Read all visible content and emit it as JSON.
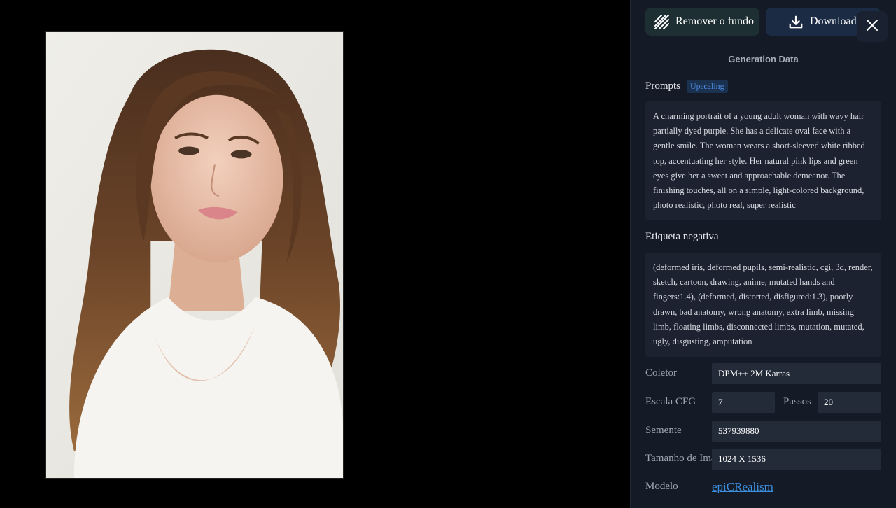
{
  "actions": {
    "remove_bg_label": "Remover o fundo",
    "download_label": "Download"
  },
  "generation": {
    "section_title": "Generation Data",
    "prompts_label": "Prompts",
    "prompts_tag": "Upscaling",
    "prompt_text": "A charming portrait of a young adult woman with wavy hair partially dyed purple. She has a delicate oval face with a gentle smile. The woman wears a short-sleeved white ribbed top, accentuating her style. Her natural pink lips and green eyes give her a sweet and approachable demeanor. The finishing touches, all on a simple, light-colored background, photo realistic, photo real, super realistic",
    "negative_label": "Etiqueta negativa",
    "negative_text": "(deformed iris, deformed pupils, semi-realistic, cgi, 3d, render, sketch, cartoon, drawing, anime, mutated hands and fingers:1.4), (deformed, distorted, disfigured:1.3), poorly drawn, bad anatomy, wrong anatomy, extra limb, missing limb, floating limbs, disconnected limbs, mutation, mutated, ugly, disgusting, amputation"
  },
  "params": {
    "sampler_label": "Coletor",
    "sampler_value": "DPM++ 2M Karras",
    "cfg_label": "Escala CFG",
    "cfg_value": "7",
    "steps_label": "Passos",
    "steps_value": "20",
    "seed_label": "Semente",
    "seed_value": "537939880",
    "size_label": "Tamanho de Imagem",
    "size_value": "1024 X 1536",
    "model_label": "Modelo",
    "model_value": "epiCRealism"
  },
  "icons": {
    "remove_bg": "diagonal-lines-icon",
    "download": "download-icon",
    "close": "close-icon"
  }
}
